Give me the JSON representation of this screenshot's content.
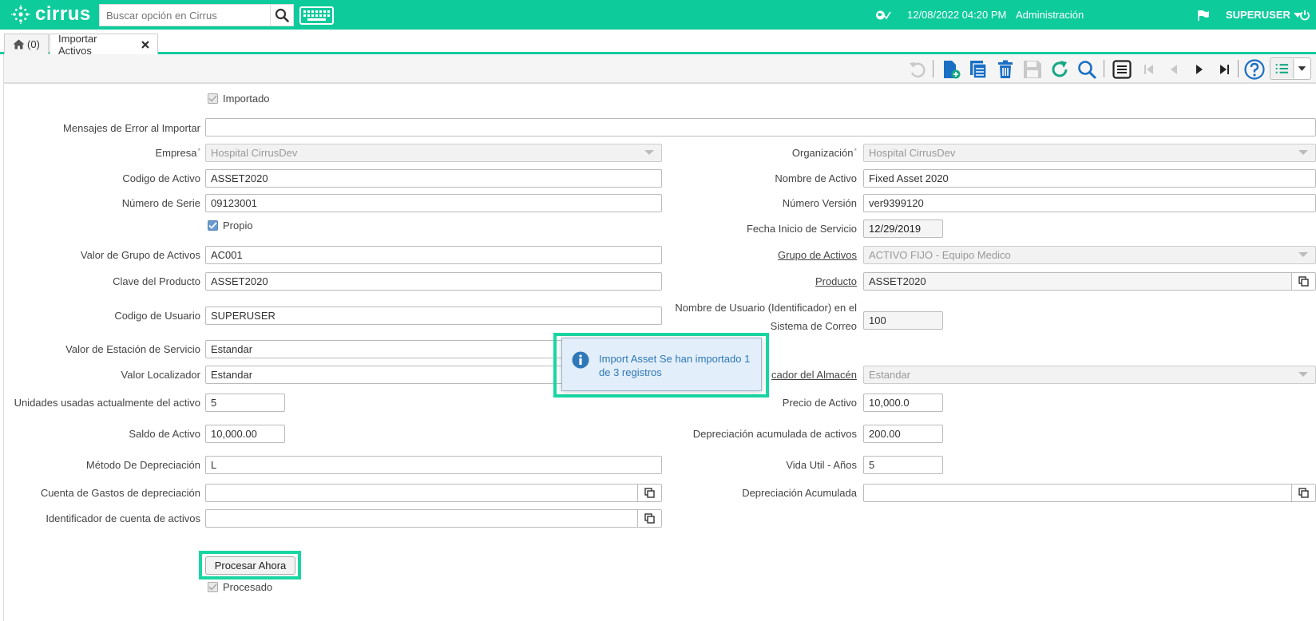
{
  "app": {
    "logo_text": "cirrus",
    "search_placeholder": "Buscar opción en Cirrus",
    "datetime": "12/08/2022 04:20 PM",
    "role": "Administración",
    "user": "SUPERUSER"
  },
  "tabs": {
    "home_count": "(0)",
    "active_label": "Importar Activos"
  },
  "form": {
    "importado_label": "Importado",
    "errmsg_label": "Mensajes de Error al Importar",
    "errmsg_value": "",
    "empresa_label": "Empresa",
    "empresa_value": "Hospital CirrusDev",
    "organizacion_label": "Organización",
    "organizacion_value": "Hospital CirrusDev",
    "codigo_activo_label": "Codigo de Activo",
    "codigo_activo_value": "ASSET2020",
    "nombre_activo_label": "Nombre de Activo",
    "nombre_activo_value": "Fixed Asset 2020",
    "numero_serie_label": "Número de Serie",
    "numero_serie_value": "09123001",
    "numero_version_label": "Número Versión",
    "numero_version_value": "ver9399120",
    "propio_label": "Propio",
    "fecha_inicio_label": "Fecha Inicio de Servicio",
    "fecha_inicio_value": "12/29/2019",
    "valor_grupo_label": "Valor de Grupo de Activos",
    "valor_grupo_value": "AC001",
    "grupo_activos_label": "Grupo de Activos",
    "grupo_activos_value": "ACTIVO FIJO - Equipo Medico",
    "clave_producto_label": "Clave del Producto",
    "clave_producto_value": "ASSET2020",
    "producto_label": "Producto",
    "producto_value": "ASSET2020",
    "codigo_usuario_label": "Codigo de Usuario",
    "codigo_usuario_value": "SUPERUSER",
    "nombre_usuario_label_1": "Nombre de Usuario (Identificador) en el",
    "nombre_usuario_label_2": "Sistema de Correo",
    "nombre_usuario_value": "100",
    "estacion_servicio_label": "Valor de Estación de Servicio",
    "estacion_servicio_value": "Estandar",
    "valor_localizador_label": "Valor Localizador",
    "valor_localizador_value": "Estandar",
    "localizador_almacen_label": "cador del Almacén",
    "localizador_almacen_value": "Estandar",
    "unidades_label": "Unidades usadas actualmente del activo",
    "unidades_value": "5",
    "precio_label": "Precio de Activo",
    "precio_value": "10,000.0",
    "saldo_label": "Saldo de Activo",
    "saldo_value": "10,000.00",
    "dep_acum_label": "Depreciación acumulada de activos",
    "dep_acum_value": "200.00",
    "metodo_label": "Método De Depreciación",
    "metodo_value": "L",
    "vida_util_label": "Vida Util - Años",
    "vida_util_value": "5",
    "cuenta_gastos_label": "Cuenta de Gastos de depreciación",
    "cuenta_gastos_value": "",
    "depreciacion_acumulada_label": "Depreciación Acumulada",
    "depreciacion_acumulada_value": "",
    "ident_cuenta_label": "Identificador de cuenta de activos",
    "ident_cuenta_value": "",
    "procesar_button": "Procesar Ahora",
    "procesado_label": "Procesado"
  },
  "popup": {
    "message": "Import Asset Se han importado 1 de 3 registros"
  },
  "colors": {
    "brand": "#0ecb9c",
    "highlight": "#18d6a2",
    "popup_text": "#2f78b8",
    "toolbar_blue": "#1a6fc4",
    "toolbar_green": "#16a884"
  }
}
